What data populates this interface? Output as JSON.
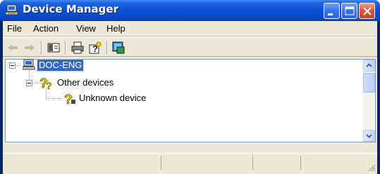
{
  "window": {
    "title": "Device Manager",
    "icon": "computer-icon"
  },
  "title_buttons": {
    "minimize": "minimize-icon",
    "maximize": "maximize-icon",
    "close": "close-icon"
  },
  "menubar": {
    "items": [
      "File",
      "Action",
      "View",
      "Help"
    ]
  },
  "toolbar": {
    "buttons": [
      "back-icon",
      "forward-icon",
      "show-hide-console-tree-icon",
      "print-icon",
      "help-icon",
      "scan-hardware-icon"
    ]
  },
  "tree": {
    "root": {
      "label": "DOC-ENG",
      "icon": "computer-icon",
      "expanded": true,
      "selected": true
    },
    "nodes": [
      {
        "label": "Other devices",
        "icon": "unknown-device-category-icon",
        "expanded": true
      },
      {
        "label": "Unknown device",
        "icon": "unknown-device-icon"
      }
    ]
  },
  "colors": {
    "titlebar": "#0d50d4",
    "selection": "#316ac5",
    "face": "#ece9d8"
  }
}
